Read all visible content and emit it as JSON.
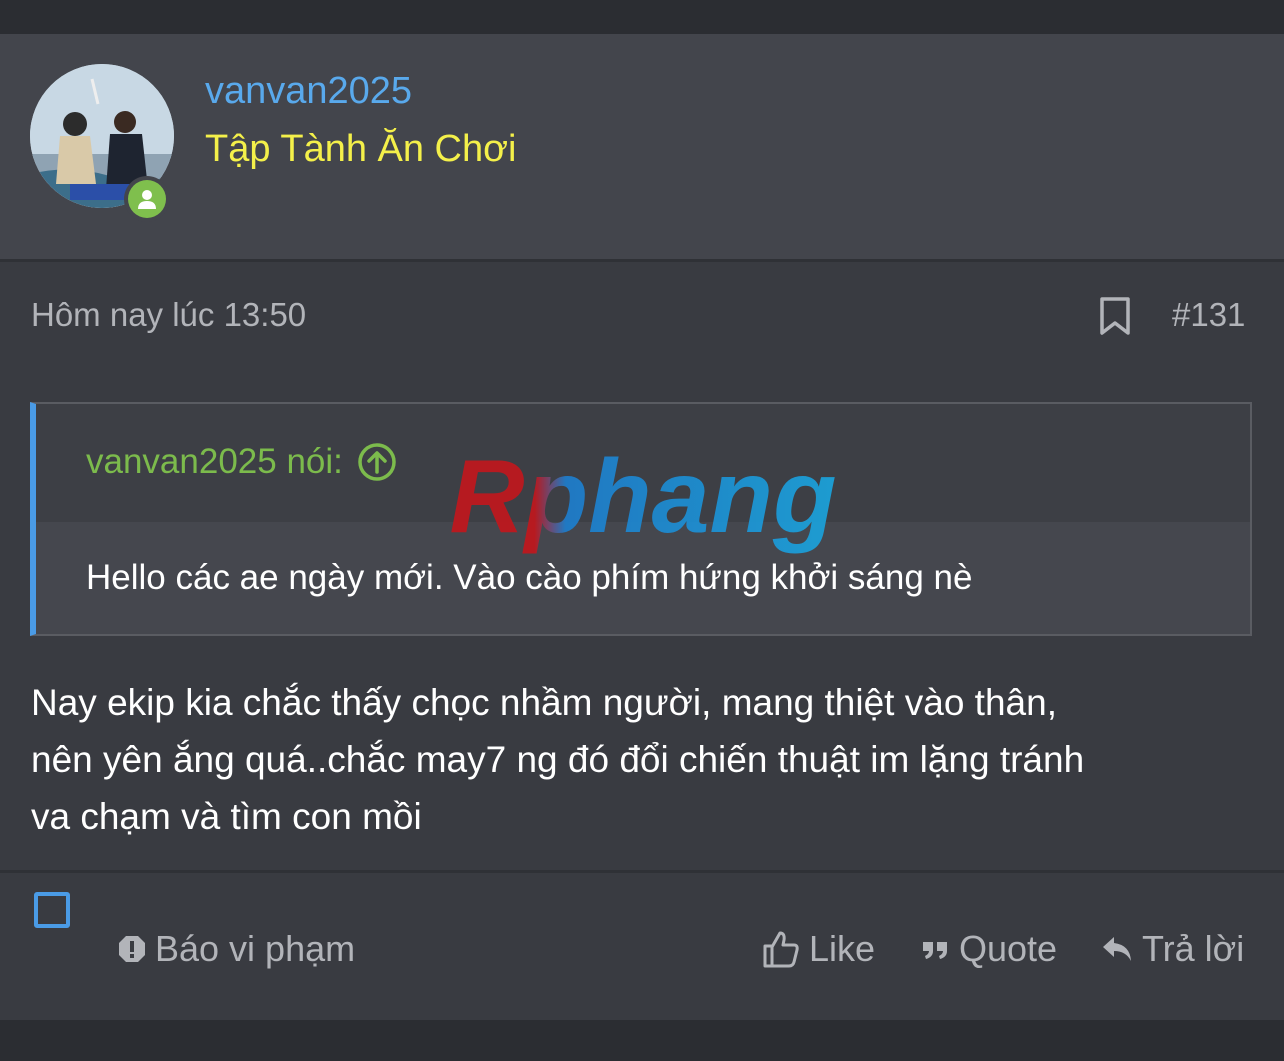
{
  "post": {
    "username": "vanvan2025",
    "user_title": "Tập Tành Ăn Chơi",
    "date": "Hôm nay lúc 13:50",
    "post_number": "#131",
    "icons": {
      "bookmark": "bookmark-icon",
      "online": "user-online-icon"
    },
    "colors": {
      "username": "#59a9ec",
      "user_title": "#f4f04a",
      "quote_accent": "#4a9be6",
      "quote_author": "#7cbb4c"
    }
  },
  "quote": {
    "author": "vanvan2025 nói:",
    "text": "Hello các ae ngày mới. Vào cào phím hứng khởi sáng nè",
    "icons": {
      "jump": "arrow-up-circle-icon"
    }
  },
  "watermark": {
    "text": "Rphang"
  },
  "message": {
    "lines": [
      "Nay ekip kia chắc thấy chọc nhầm người, mang thiệt vào thân,",
      "nên yên ắng quá..chắc may7 ng đó đổi chiến thuật im lặng tránh",
      "va chạm và tìm con mồi"
    ]
  },
  "footer": {
    "report_label": "Báo vi phạm",
    "like_label": "Like",
    "quote_label": "Quote",
    "reply_label": "Trả lời",
    "icons": {
      "select": "checkbox-icon",
      "report": "alert-icon",
      "like": "thumbs-up-icon",
      "quote": "quote-icon",
      "reply": "reply-icon"
    }
  }
}
